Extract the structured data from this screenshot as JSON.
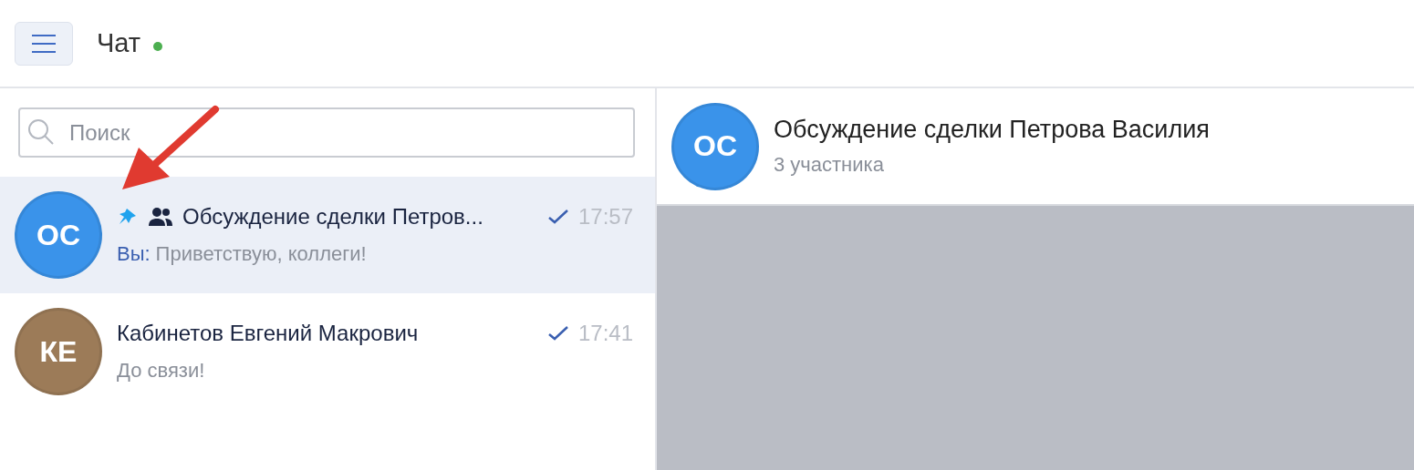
{
  "header": {
    "title": "Чат",
    "online": true
  },
  "search": {
    "placeholder": "Поиск"
  },
  "chats": [
    {
      "initials": "ОС",
      "color": "#3a93ea",
      "pinned": true,
      "group": true,
      "name": "Обсуждение сделки Петров...",
      "time": "17:57",
      "read": true,
      "sender": "Вы:",
      "preview": "Приветствую, коллеги!",
      "selected": true
    },
    {
      "initials": "КЕ",
      "color": "#9c7b58",
      "pinned": false,
      "group": false,
      "name": "Кабинетов Евгений Макрович",
      "time": "17:41",
      "read": true,
      "preview": "До связи!",
      "selected": false
    }
  ],
  "conversation": {
    "initials": "ОС",
    "color": "#3a93ea",
    "title": "Обсуждение сделки Петрова Василия",
    "subtitle": "3 участника"
  }
}
